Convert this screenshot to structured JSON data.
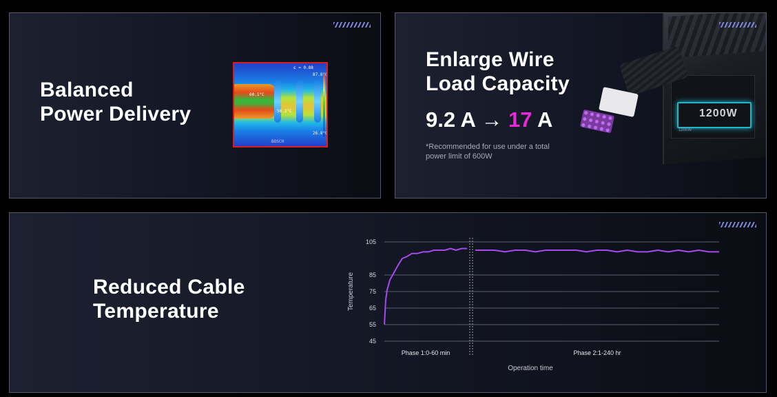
{
  "panels": {
    "balanced": {
      "title_line1": "Balanced",
      "title_line2": "Power Delivery",
      "thermal": {
        "emissivity": "ε = 0.88",
        "max_temp": "87.8°C",
        "min_temp": "26.8°C",
        "spot1": "60.1°C",
        "spot2": "56.2°C",
        "brand": "BOSCH"
      }
    },
    "wire": {
      "title_line1": "Enlarge Wire",
      "title_line2": "Load Capacity",
      "from_value": "9.2 A",
      "arrow": "→",
      "to_number": "17",
      "to_unit": "A",
      "note_line1": "*Recommended for use under a total",
      "note_line2": "power limit of 600W",
      "psu_label": "1200W",
      "psu_sublabel": "1200W"
    },
    "cable": {
      "title_line1": "Reduced Cable",
      "title_line2": "Temperature"
    }
  },
  "colors": {
    "accent_magenta": "#e62ad7",
    "line_purple": "#a648f2",
    "stripes": "#7d86d9"
  },
  "chart_data": {
    "type": "line",
    "ylabel": "Temperature",
    "xlabel": "Operation time",
    "yticks": [
      45,
      55,
      65,
      75,
      85,
      105
    ],
    "ylim": [
      45,
      105
    ],
    "phases": [
      {
        "label": "Phase 1:0-60 min",
        "x": [
          0,
          1,
          2,
          4,
          6,
          8,
          10,
          13,
          16,
          20,
          24,
          28,
          32,
          36,
          40,
          44,
          48,
          52,
          56,
          60
        ],
        "values": [
          55,
          70,
          76,
          82,
          85,
          88,
          91,
          95,
          96,
          98,
          98,
          99,
          99,
          100,
          100,
          100,
          101,
          100,
          101,
          101
        ]
      },
      {
        "label": "Phase 2:1-240 hr",
        "x": [
          1,
          10,
          20,
          30,
          40,
          50,
          60,
          70,
          80,
          90,
          100,
          110,
          120,
          130,
          140,
          150,
          160,
          170,
          180,
          190,
          200,
          210,
          220,
          230,
          240
        ],
        "values": [
          100,
          100,
          100,
          99,
          100,
          100,
          99,
          100,
          100,
          100,
          100,
          99,
          100,
          100,
          99,
          100,
          99,
          99,
          100,
          99,
          100,
          99,
          100,
          99,
          99
        ]
      }
    ],
    "grid": true,
    "legend": "none"
  }
}
